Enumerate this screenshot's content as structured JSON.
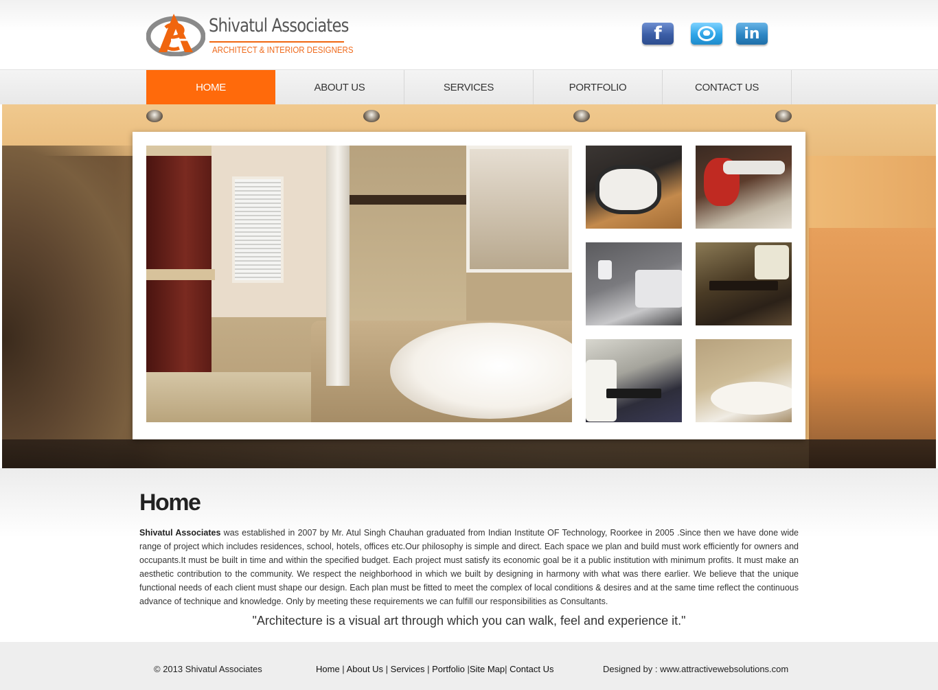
{
  "brand": {
    "name": "Shivatul Associates",
    "tagline": "ARCHITECT & INTERIOR DESIGNERS",
    "logo_icon": "sa-monogram-logo",
    "accent": "#ff6a0b"
  },
  "social": [
    {
      "name": "facebook",
      "glyph": "f"
    },
    {
      "name": "twitter",
      "glyph": ""
    },
    {
      "name": "linkedin",
      "glyph": "in"
    }
  ],
  "nav": {
    "items": [
      {
        "label": "HOME",
        "active": true
      },
      {
        "label": "ABOUT US",
        "active": false
      },
      {
        "label": "SERVICES",
        "active": false
      },
      {
        "label": "PORTFOLIO",
        "active": false
      },
      {
        "label": "CONTACT US",
        "active": false
      }
    ]
  },
  "content": {
    "heading": "Home",
    "intro_bold": "Shivatul Associates",
    "intro_text": " was established in 2007 by Mr. Atul Singh Chauhan graduated from Indian Institute OF Technology, Roorkee in 2005 .Since then we have done wide range of project which includes residences, school, hotels, offices etc.Our philosophy is simple and direct. Each space we plan and build must work efficiently for owners and occupants.It must be built in time and within the specified budget. Each project must satisfy its economic goal be it a public institution with minimum profits. It must make an aesthetic contribution to the community. We respect the neighborhood in which we built by designing in harmony with what was there earlier. We believe that the unique functional needs of each client must shape our design. Each plan must be fitted to meet the complex of local conditions & desires and at the same time reflect the continuous advance of technique and knowledge. Only by meeting these requirements we can fulfill our responsibilities as Consultants.",
    "quote": "\"Architecture is a visual art through which you can walk, feel and experience it.\""
  },
  "footer": {
    "copyright": "© 2013 Shivatul Associates",
    "links": [
      {
        "label": "Home",
        "sep": " | "
      },
      {
        "label": "About Us",
        "sep": " | "
      },
      {
        "label": "Services",
        "sep": " | "
      },
      {
        "label": "Portfolio",
        "sep": " |"
      },
      {
        "label": "Site Map",
        "sep": "| "
      },
      {
        "label": "Contact Us",
        "sep": ""
      }
    ],
    "designed_by": "Designed by : www.attractivewebsolutions.com"
  }
}
